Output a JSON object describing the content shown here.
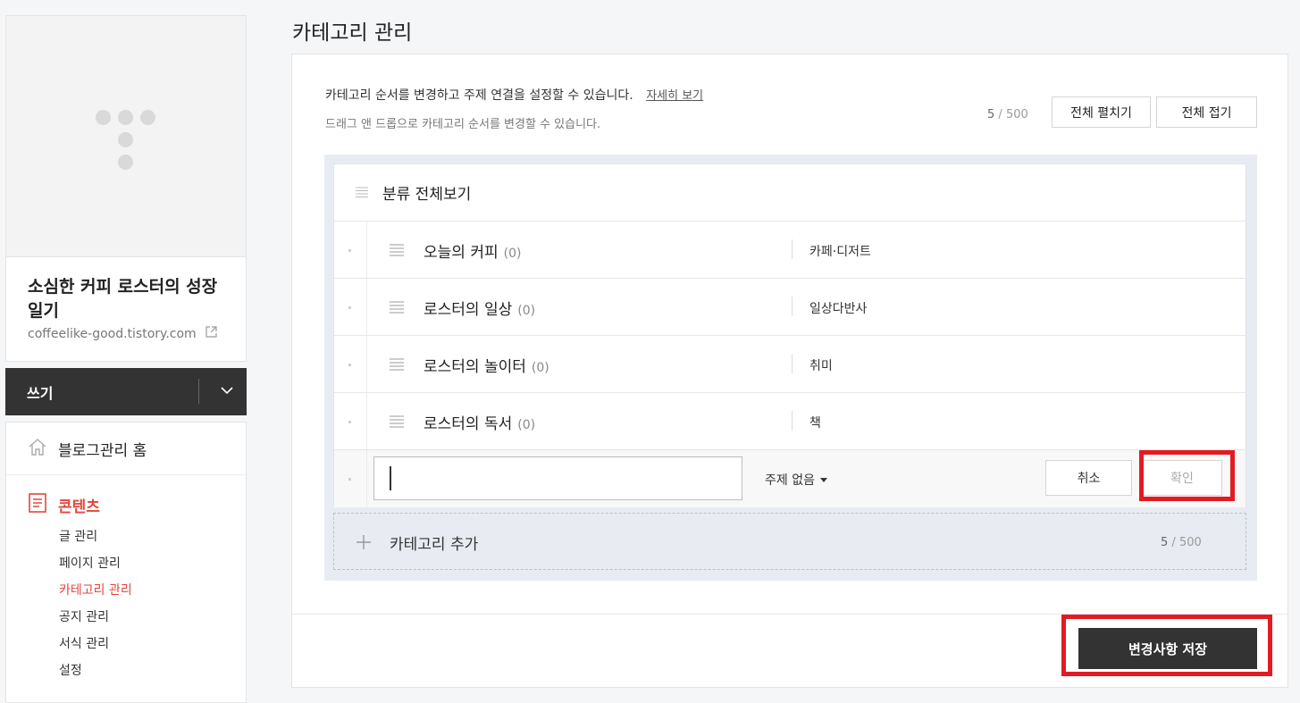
{
  "sidebar": {
    "blog_title": "소심한 커피 로스터의 성장 일기",
    "blog_url": "coffeelike-good.tistory.com",
    "write_label": "쓰기",
    "home_label": "블로그관리 홈",
    "section_label": "콘텐츠",
    "submenu": [
      "글 관리",
      "페이지 관리",
      "카테고리 관리",
      "공지 관리",
      "서식 관리",
      "설정"
    ],
    "active_submenu": "카테고리 관리",
    "accent_color": "#e3463c"
  },
  "main": {
    "page_title": "카테고리 관리",
    "description": "카테고리 순서를 변경하고 주제 연결을 설정할 수 있습니다.",
    "detail_link": "자세히 보기",
    "drag_hint": "드래그 앤 드롭으로 카테고리 순서를 변경할 수 있습니다.",
    "count_current": "5",
    "count_max": "500",
    "expand_all_label": "전체 펼치기",
    "collapse_all_label": "전체 접기",
    "root_label": "분류 전체보기",
    "categories": [
      {
        "name": "오늘의 커피",
        "count": "(0)",
        "topic": "카페·디저트"
      },
      {
        "name": "로스터의 일상",
        "count": "(0)",
        "topic": "일상다반사"
      },
      {
        "name": "로스터의 놀이터",
        "count": "(0)",
        "topic": "취미"
      },
      {
        "name": "로스터의 독서",
        "count": "(0)",
        "topic": "책"
      }
    ],
    "edit_row": {
      "input_value": "",
      "topic_select": "주제 없음",
      "cancel_label": "취소",
      "confirm_label": "확인"
    },
    "add_category_label": "카테고리 추가",
    "save_label": "변경사항 저장",
    "highlight_color": "#e21b23"
  }
}
